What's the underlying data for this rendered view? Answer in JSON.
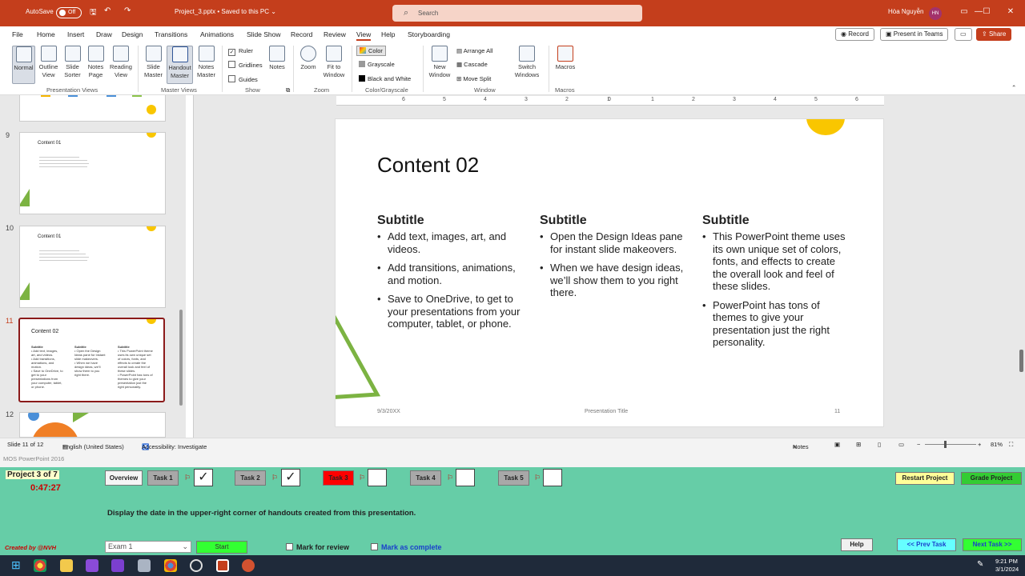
{
  "titlebar": {
    "autosave_label": "AutoSave",
    "autosave_state": "Off",
    "doc_title": "Project_3.pptx • Saved to this PC ⌄",
    "search_placeholder": "Search",
    "user_name": "Hòa Nguyễn",
    "user_initials": "HN"
  },
  "menu": {
    "tabs": [
      "File",
      "Home",
      "Insert",
      "Draw",
      "Design",
      "Transitions",
      "Animations",
      "Slide Show",
      "Record",
      "Review",
      "View",
      "Help",
      "Storyboarding"
    ],
    "active_tab": "View",
    "record_label": "Record",
    "teams_label": "Present in Teams",
    "share_label": "Share"
  },
  "ribbon": {
    "presentation_views": [
      "Normal",
      "Outline View",
      "Slide Sorter",
      "Notes Page",
      "Reading View"
    ],
    "master_views": [
      "Slide Master",
      "Handout Master",
      "Notes Master"
    ],
    "show": {
      "ruler": "Ruler",
      "gridlines": "Gridlines",
      "guides": "Guides",
      "notes": "Notes"
    },
    "zoom": {
      "zoom": "Zoom",
      "fit": "Fit to Window"
    },
    "color": {
      "color": "Color",
      "grayscale": "Grayscale",
      "bw": "Black and White"
    },
    "window": {
      "new": "New Window",
      "arrange": "Arrange All",
      "cascade": "Cascade",
      "move_split": "Move Split",
      "switch": "Switch Windows"
    },
    "macros": "Macros",
    "groups": [
      "Presentation Views",
      "Master Views",
      "Show",
      "Zoom",
      "Color/Grayscale",
      "Window",
      "Macros"
    ]
  },
  "ruler_ticks": [
    "6",
    "5",
    "4",
    "3",
    "2",
    "1",
    "0",
    "1",
    "2",
    "3",
    "4",
    "5",
    "6"
  ],
  "thumbnails": [
    {
      "num": "9",
      "title": "Content 01"
    },
    {
      "num": "10",
      "title": "Content 01"
    },
    {
      "num": "11",
      "title": "Content 02"
    },
    {
      "num": "12",
      "title": ""
    }
  ],
  "slide": {
    "title": "Content 02",
    "columns": [
      {
        "subtitle": "Subtitle",
        "bullets": [
          "Add text, images, art, and videos.",
          "Add transitions, animations, and motion.",
          "Save to OneDrive, to get to your presentations from your computer, tablet, or phone."
        ]
      },
      {
        "subtitle": "Subtitle",
        "bullets": [
          "Open the Design Ideas pane for instant slide makeovers.",
          "When we have design ideas, we’ll show them to you right there."
        ]
      },
      {
        "subtitle": "Subtitle",
        "bullets": [
          "This PowerPoint theme uses its own unique set of colors, fonts, and effects to create the overall look and feel of these slides.",
          "PowerPoint has tons of themes to give your presentation just the right personality."
        ]
      }
    ],
    "footer_date": "9/3/20XX",
    "footer_title": "Presentation Title",
    "footer_num": "11"
  },
  "status": {
    "slide_count": "Slide 11 of 12",
    "language": "English (United States)",
    "accessibility": "Accessibility: Investigate",
    "notes": "Notes",
    "zoom": "81%"
  },
  "exam": {
    "app_title": "MOS PowerPoint 2016",
    "project": "Project 3 of 7",
    "timer": "0:47:27",
    "overview": "Overview",
    "tasks": [
      "Task 1",
      "Task 2",
      "Task 3",
      "Task 4",
      "Task 5"
    ],
    "restart": "Restart Project",
    "grade": "Grade Project",
    "instruction": "Display the date in the upper-right corner of handouts created from this presentation.",
    "credit": "Created by @NVH",
    "exam_select": "Exam 1",
    "start": "Start",
    "mark_review": "Mark for review",
    "mark_complete": "Mark as complete",
    "help": "Help",
    "prev": "<< Prev Task",
    "next": "Next Task >>"
  },
  "taskbar": {
    "time": "9:21 PM",
    "date": "3/1/2024"
  }
}
